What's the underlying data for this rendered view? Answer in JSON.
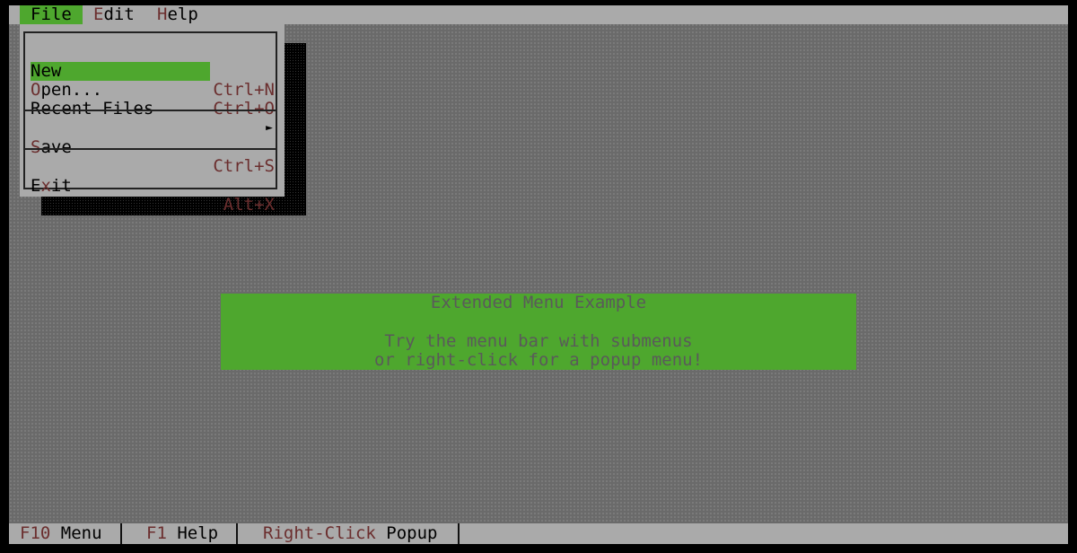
{
  "menubar": {
    "items": [
      {
        "hotkey": "F",
        "rest": "ile"
      },
      {
        "hotkey": "E",
        "rest": "dit"
      },
      {
        "hotkey": "H",
        "rest": "elp"
      }
    ]
  },
  "file_menu": {
    "new": {
      "label": "New",
      "shortcut": "Ctrl+N"
    },
    "open": {
      "hotkey": "O",
      "rest": "pen...",
      "shortcut": "Ctrl+O"
    },
    "recent": {
      "label": "Recent Files",
      "arrow": "►"
    },
    "save": {
      "hotkey": "S",
      "rest": "ave",
      "shortcut": "Ctrl+S"
    },
    "exit": {
      "pre": "E",
      "hotkey": "x",
      "rest": "it",
      "shortcut": "Alt+X"
    }
  },
  "message": {
    "title": "Extended Menu Example",
    "line1": "Try the menu bar with submenus",
    "line2": "or right-click for a popup menu!"
  },
  "statusbar": {
    "items": [
      {
        "key": "F10",
        "label": " Menu"
      },
      {
        "key": "F1",
        "label": " Help"
      },
      {
        "key": "Right-Click",
        "label": " Popup"
      }
    ]
  },
  "colors": {
    "highlight": "#4ea72e",
    "menu_bg": "#aaaaaa",
    "hotkey": "#6b2e2e"
  }
}
